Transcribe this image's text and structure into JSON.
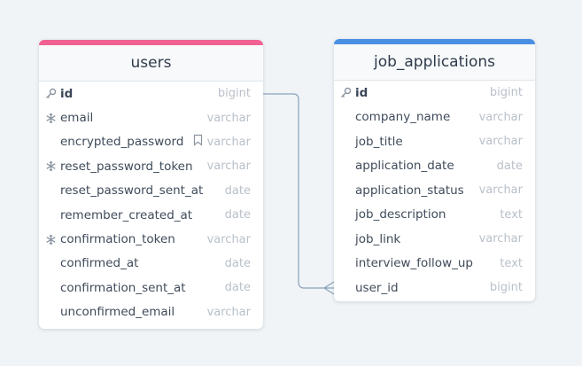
{
  "colors": {
    "users_accent": "#f06292",
    "job_applications_accent": "#4a90e2",
    "connector": "#8aa0b8"
  },
  "tables": {
    "users": {
      "name": "users",
      "columns": [
        {
          "name": "id",
          "type": "bigint",
          "icon": "key-icon",
          "primary": true
        },
        {
          "name": "email",
          "type": "varchar",
          "icon": "snowflake-icon"
        },
        {
          "name": "encrypted_password",
          "type": "varchar",
          "icon": "",
          "note": "bookmark-icon"
        },
        {
          "name": "reset_password_token",
          "type": "varchar",
          "icon": "snowflake-icon"
        },
        {
          "name": "reset_password_sent_at",
          "type": "date",
          "icon": ""
        },
        {
          "name": "remember_created_at",
          "type": "date",
          "icon": ""
        },
        {
          "name": "confirmation_token",
          "type": "varchar",
          "icon": "snowflake-icon"
        },
        {
          "name": "confirmed_at",
          "type": "date",
          "icon": ""
        },
        {
          "name": "confirmation_sent_at",
          "type": "date",
          "icon": ""
        },
        {
          "name": "unconfirmed_email",
          "type": "varchar",
          "icon": ""
        }
      ]
    },
    "job_applications": {
      "name": "job_applications",
      "columns": [
        {
          "name": "id",
          "type": "bigint",
          "icon": "key-icon",
          "primary": true
        },
        {
          "name": "company_name",
          "type": "varchar",
          "icon": ""
        },
        {
          "name": "job_title",
          "type": "varchar",
          "icon": ""
        },
        {
          "name": "application_date",
          "type": "date",
          "icon": ""
        },
        {
          "name": "application_status",
          "type": "varchar",
          "icon": ""
        },
        {
          "name": "job_description",
          "type": "text",
          "icon": ""
        },
        {
          "name": "job_link",
          "type": "varchar",
          "icon": ""
        },
        {
          "name": "interview_follow_up",
          "type": "text",
          "icon": ""
        },
        {
          "name": "user_id",
          "type": "bigint",
          "icon": ""
        }
      ]
    }
  },
  "relationship": {
    "from": "users.id",
    "to": "job_applications.user_id",
    "cardinality": "one-to-many"
  }
}
